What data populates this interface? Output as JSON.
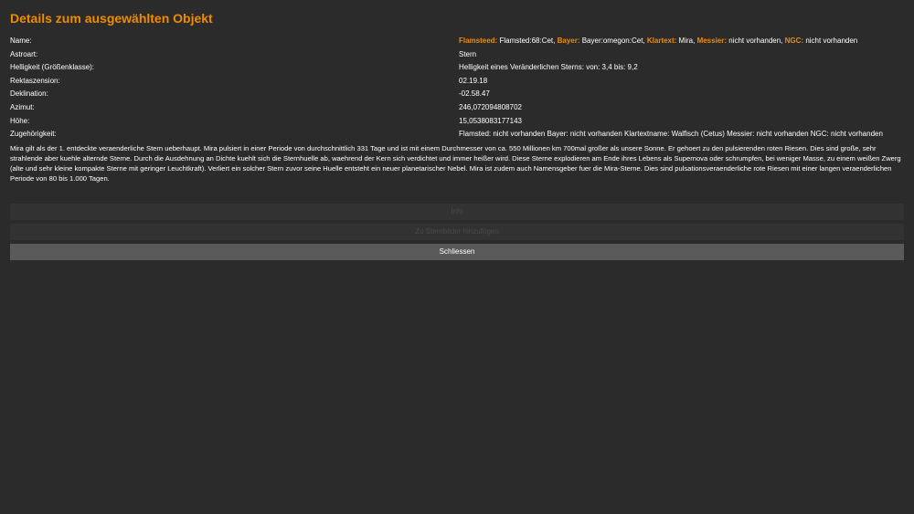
{
  "window": {
    "title": "Details zum ausgewählten Objekt"
  },
  "details": [
    {
      "label": "Name:",
      "value_parts": [
        {
          "text": "Flamsteed:",
          "hl": true
        },
        {
          "text": " Flamsted:68:Cet, ",
          "hl": false
        },
        {
          "text": "Bayer:",
          "hl": true
        },
        {
          "text": " Bayer:omegon:Cet, ",
          "hl": false
        },
        {
          "text": "Klartext:",
          "hl": true
        },
        {
          "text": " Mira, ",
          "hl": false
        },
        {
          "text": "Messier:",
          "hl": true
        },
        {
          "text": " nicht vorhanden, ",
          "hl": false
        },
        {
          "text": "NGC:",
          "hl": true
        },
        {
          "text": " nicht vorhanden",
          "hl": false
        }
      ]
    },
    {
      "label": "Astroart:",
      "value": "Stern"
    },
    {
      "label": "Helligkeit (Größenklasse):",
      "value": "Helligkeit eines Veränderlichen Sterns: von: 3,4 bis: 9,2"
    },
    {
      "label": "Rektaszension:",
      "value": "02.19.18"
    },
    {
      "label": "Deklination:",
      "value": "-02.58.47"
    },
    {
      "label": "Azimut:",
      "value": "246,072094808702"
    },
    {
      "label": "Höhe:",
      "value": "15,0538083177143"
    },
    {
      "label": "Zugehörigkeit:",
      "value": "Flamsted: nicht vorhanden  Bayer: nicht vorhanden  Klartextname: Walfisch (Cetus) Messier: nicht vorhanden NGC: nicht vorhanden"
    }
  ],
  "description": "Mira gilt als der 1. entdeckte veraenderliche Stern ueberhaupt. Mira pulsiert in einer Periode von durchschnittlich 331 Tage und ist mit einem Durchmesser von ca. 550 Millionen km 700mal großer als unsere Sonne. Er gehoert zu den pulsierenden roten Riesen. Dies sind große, sehr strahlende aber kuehle alternde Sterne. Durch die Ausdehnung an Dichte kuehlt sich die Sternhuelle  ab, waehrend der Kern sich verdichtet und immer heißer wird. Diese Sterne explodieren am Ende ihres Lebens als Supernova oder schrumpfen, bei weniger Masse, zu einem weißen Zwerg (alte und sehr kleine kompakte Sterne mit geringer Leuchtkraft). Verliert ein solcher Stern zuvor seine Huelle entsteht ein neuer planetarischer Nebel. Mira ist zudem auch Namensgeber fuer die Mira-Sterne. Dies sind pulsationsveraenderliche rote Riesen mit einer langen veraenderlichen Periode von 80 bis 1.000 Tagen.",
  "buttons": {
    "info": "Info",
    "add": "Zu Sternbilder hinzufügen",
    "close": "Schliessen"
  },
  "colors": {
    "accent": "#f08c00",
    "background": "#2b2b2b",
    "button_active": "#5a5a5a",
    "button_disabled": "#323232"
  }
}
